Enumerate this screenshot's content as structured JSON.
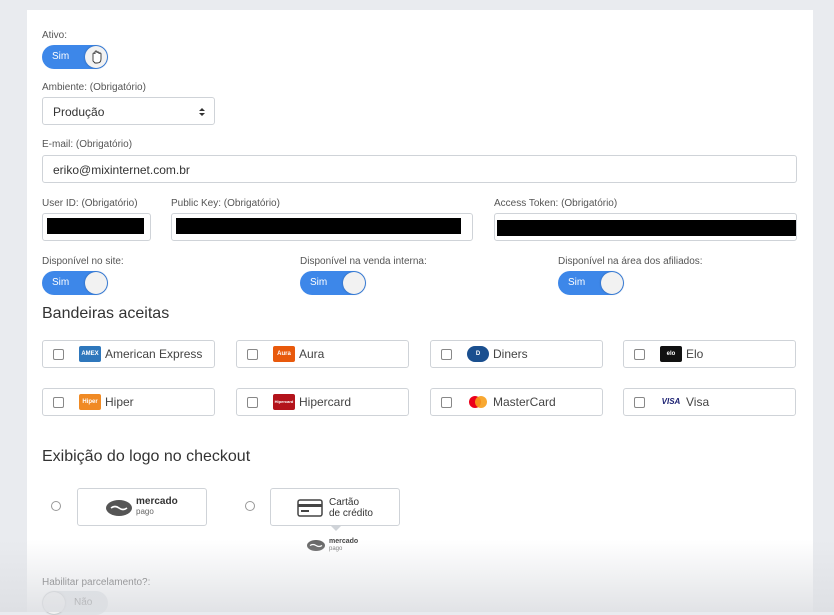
{
  "ativo": {
    "label": "Ativo:",
    "toggle": "Sim"
  },
  "ambiente": {
    "label": "Ambiente: (Obrigatório)",
    "value": "Produção"
  },
  "email": {
    "label": "E-mail: (Obrigatório)",
    "value": "eriko@mixinternet.com.br"
  },
  "credentials": {
    "user_id_label": "User ID: (Obrigatório)",
    "public_key_label": "Public Key: (Obrigatório)",
    "access_token_label": "Access Token: (Obrigatório)"
  },
  "availability": [
    {
      "label": "Disponível no site:",
      "value": "Sim"
    },
    {
      "label": "Disponível na venda interna:",
      "value": "Sim"
    },
    {
      "label": "Disponível na área dos afiliados:",
      "value": "Sim"
    }
  ],
  "bandeiras": {
    "title": "Bandeiras aceitas",
    "items": [
      {
        "name": "American Express",
        "icon": "amex-icon",
        "color": "#2e77bc",
        "icon_text": "AMEX"
      },
      {
        "name": "Aura",
        "icon": "aura-icon",
        "color": "#e8590c",
        "icon_text": "Aura"
      },
      {
        "name": "Diners",
        "icon": "diners-icon",
        "color": "#1a4f8f",
        "icon_text": "D"
      },
      {
        "name": "Elo",
        "icon": "elo-icon",
        "color": "#111111",
        "icon_text": "elo"
      },
      {
        "name": "Hiper",
        "icon": "hiper-icon",
        "color": "#f08a24",
        "icon_text": "Hiper"
      },
      {
        "name": "Hipercard",
        "icon": "hipercard-icon",
        "color": "#b3131b",
        "icon_text": "Hipercard"
      },
      {
        "name": "MasterCard",
        "icon": "mastercard-icon",
        "color": "#eb001b",
        "icon_text": ""
      },
      {
        "name": "Visa",
        "icon": "visa-icon",
        "color": "#1a1f71",
        "icon_text": "VISA"
      }
    ]
  },
  "logo_section": {
    "title": "Exibição do logo no checkout",
    "mercado_logo_line1": "mercado",
    "mercado_logo_line2": "pago",
    "card_option_line1": "Cartão",
    "card_option_line2": "de crédito",
    "small_logo_line1": "mercado",
    "small_logo_line2": "pago"
  },
  "parcelamento": {
    "label": "Habilitar parcelamento?:",
    "toggle": "Não"
  },
  "colors": {
    "accent": "#3d87e9"
  }
}
